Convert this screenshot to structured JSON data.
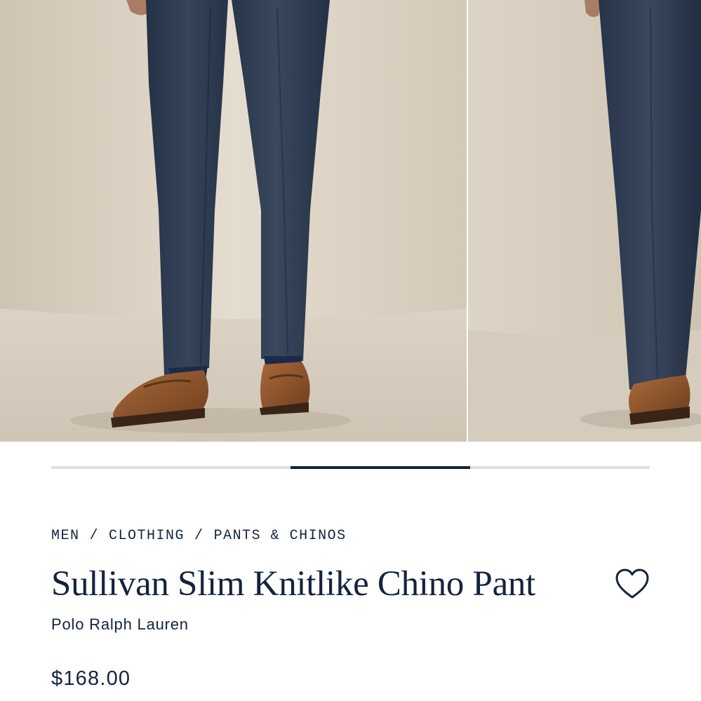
{
  "gallery": {
    "images": [
      {
        "name": "front-view",
        "alt": ""
      },
      {
        "name": "side-view",
        "alt": ""
      }
    ],
    "progress": {
      "start_fraction": 0.4,
      "end_fraction": 0.7
    }
  },
  "breadcrumb": {
    "items": [
      "MEN",
      "CLOTHING",
      "PANTS & CHINOS"
    ],
    "separator": "/"
  },
  "product": {
    "title": "Sullivan Slim Knitlike Chino Pant",
    "brand": "Polo Ralph Lauren",
    "price": "$168.00",
    "wishlist_icon": "heart-outline-icon"
  },
  "colors": {
    "navy": "#13233f",
    "track": "#dddfe3",
    "backdrop": "#e2dacd",
    "pant": "#2e3b4f",
    "loafer": "#8b522a"
  }
}
